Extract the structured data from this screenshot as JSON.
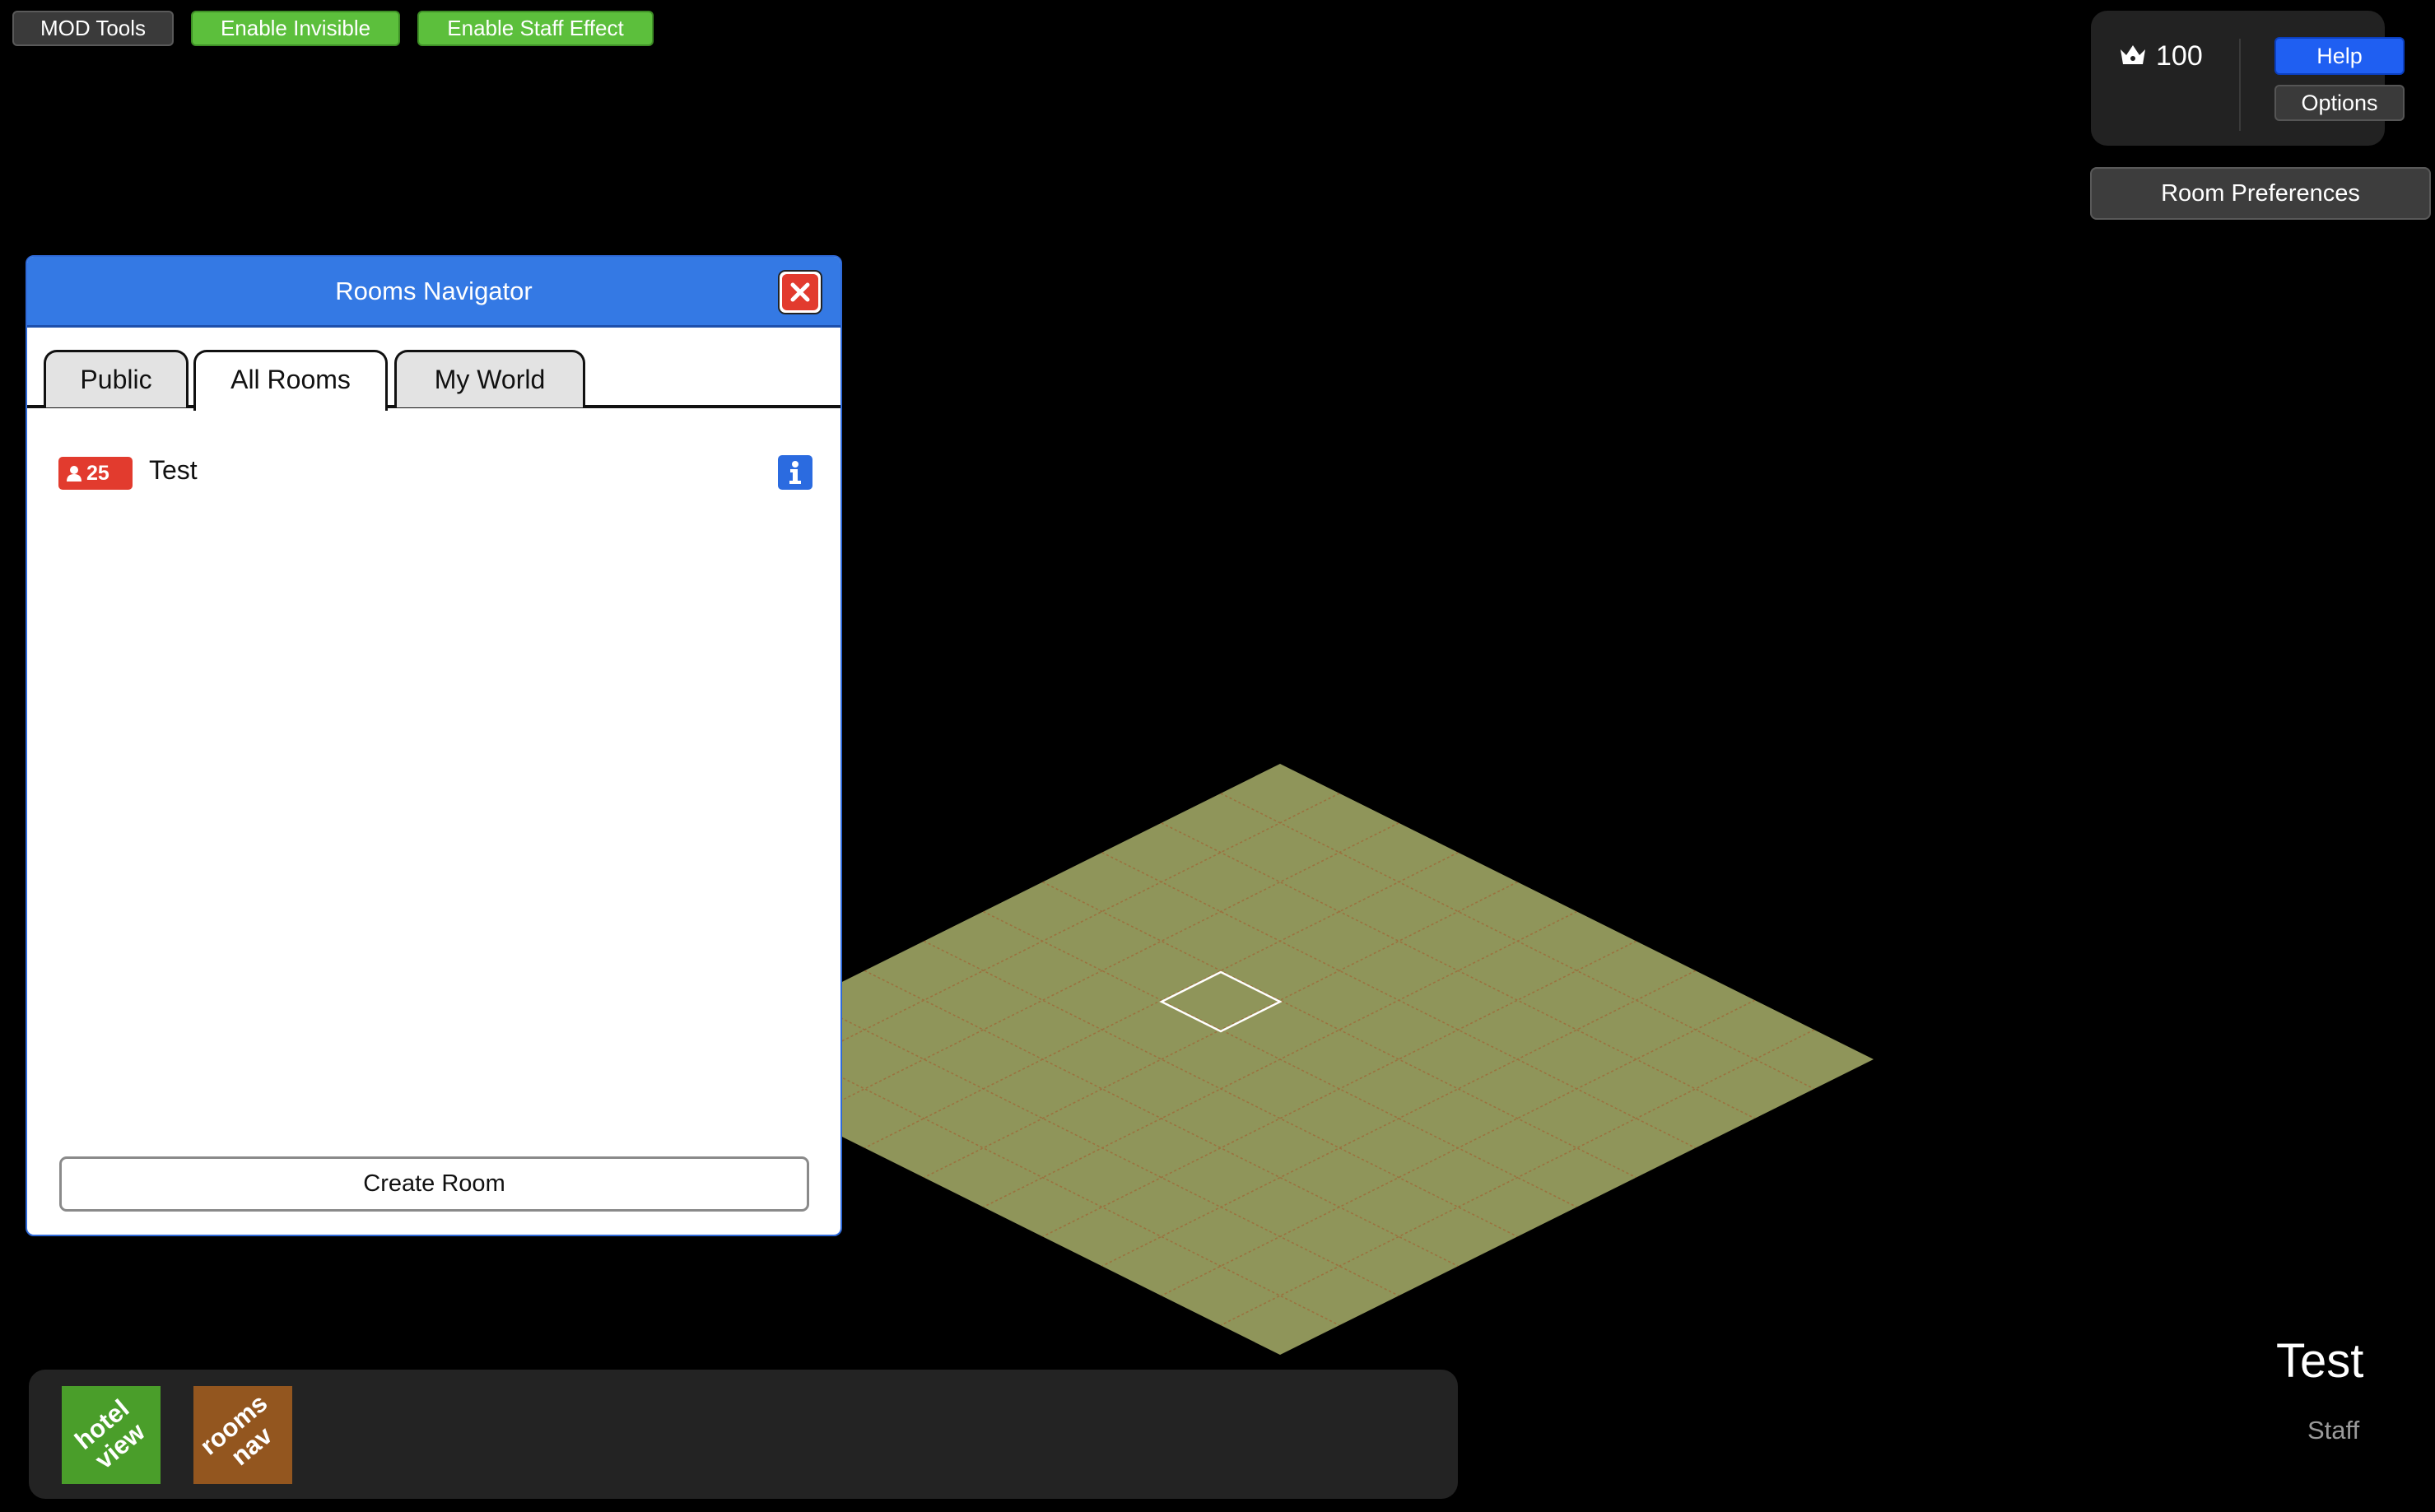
{
  "toolbar": {
    "mod_tools": "MOD Tools",
    "enable_invisible": "Enable Invisible",
    "enable_staff_effect": "Enable Staff Effect"
  },
  "hud": {
    "credits": "100",
    "help": "Help",
    "options": "Options",
    "room_preferences": "Room Preferences"
  },
  "navigator": {
    "title": "Rooms Navigator",
    "tabs": [
      {
        "label": "Public",
        "active": false
      },
      {
        "label": "All Rooms",
        "active": true
      },
      {
        "label": "My World",
        "active": false
      }
    ],
    "rooms": [
      {
        "users": "25",
        "name": "Test"
      }
    ],
    "create_room": "Create Room"
  },
  "dock": {
    "hotel_view": "hotel view",
    "rooms_nav": "rooms nav"
  },
  "room_info": {
    "name": "Test",
    "rank": "Staff"
  },
  "colors": {
    "background": "#000000",
    "navigator_header": "#3479e4",
    "accent_green": "#5cbf3c",
    "help_blue": "#1f5ff2",
    "badge_red": "#e23b2e",
    "floor": "#8f955a",
    "hotel_view_tile": "#4a9e2a",
    "rooms_nav_tile": "#93561f"
  },
  "icons": {
    "crown": "crown-icon",
    "close": "close-icon",
    "user": "user-icon",
    "info": "info-icon"
  }
}
